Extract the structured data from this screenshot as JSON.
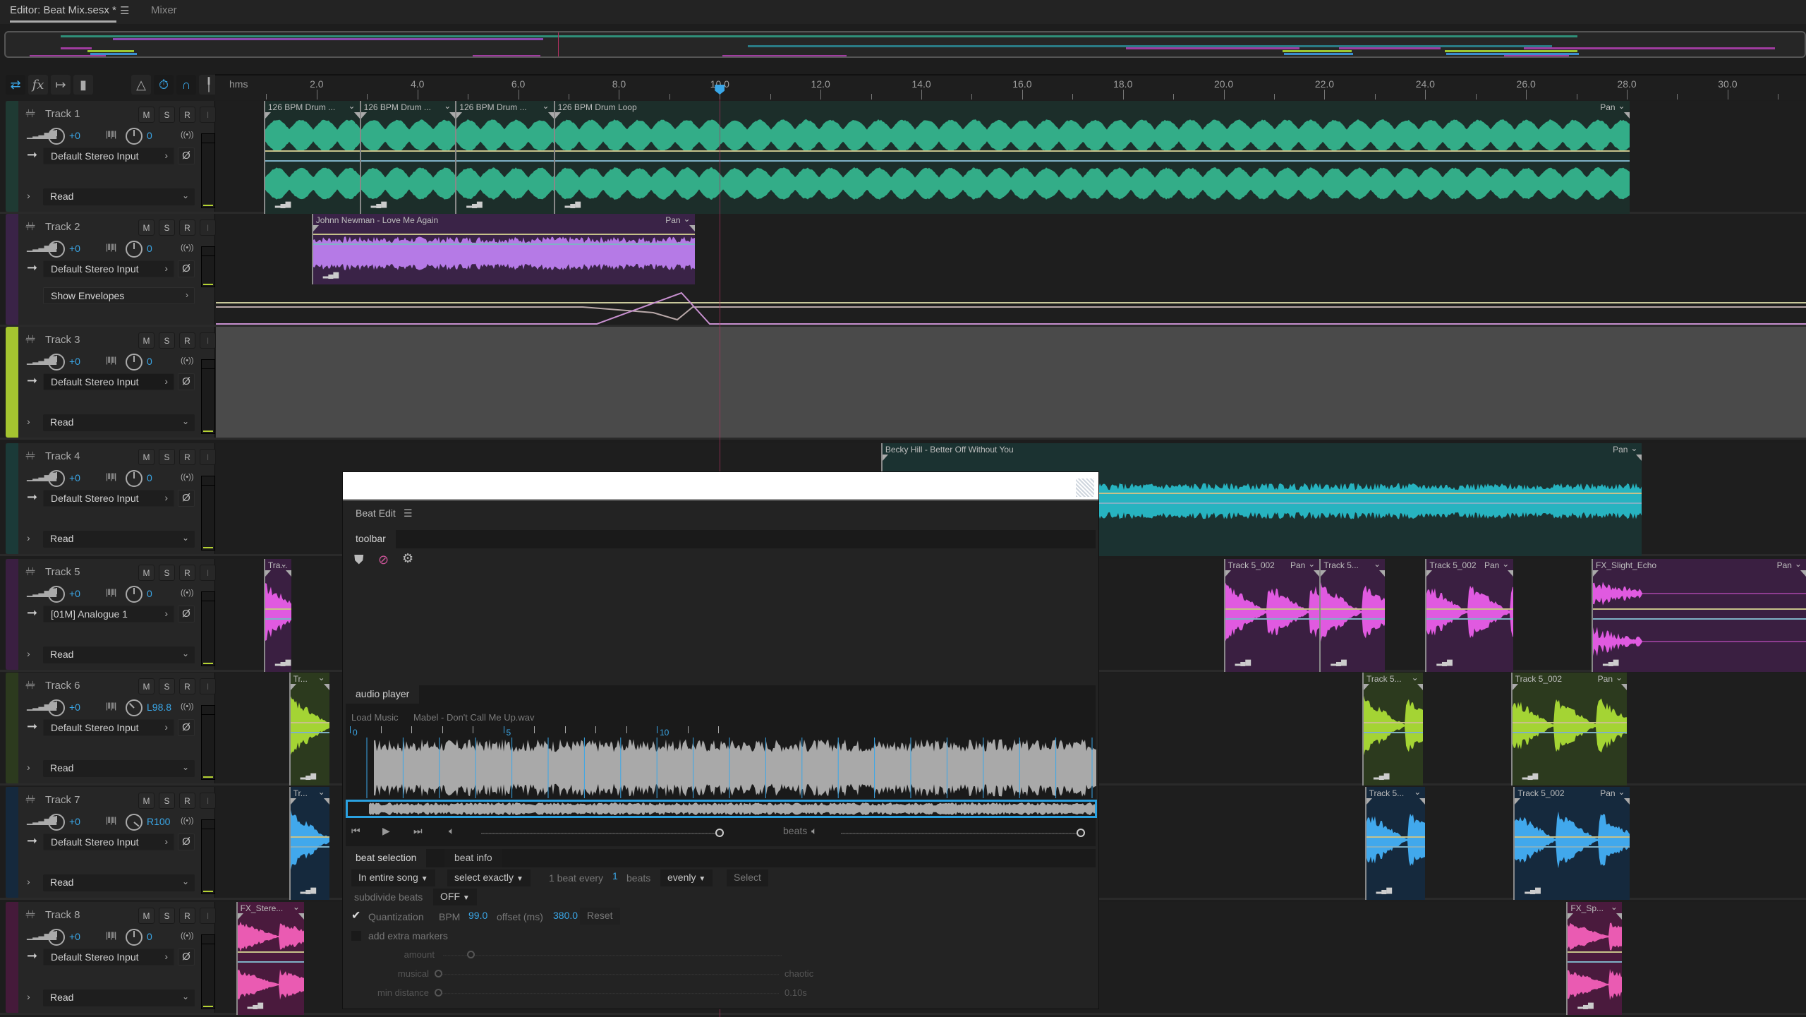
{
  "tabs": {
    "editor": "Editor: Beat Mix.sesx *",
    "menu_icon": "☰",
    "mixer": "Mixer"
  },
  "ruler": {
    "unit": "hms",
    "labels": [
      "2.0",
      "4.0",
      "6.0",
      "8.0",
      "10.0",
      "12.0",
      "14.0",
      "16.0",
      "18.0",
      "20.0",
      "22.0",
      "24.0",
      "26.0",
      "28.0",
      "30.0"
    ],
    "playhead_seconds": 10.0
  },
  "tracks": [
    {
      "name": "Track 1",
      "volume": "+0",
      "pan": "0",
      "input": "Default Stereo Input",
      "automation": "Read",
      "color": "#1f3a33"
    },
    {
      "name": "Track 2",
      "volume": "+0",
      "pan": "0",
      "input": "Default Stereo Input",
      "automation": "Show Envelopes",
      "color": "#3a2347"
    },
    {
      "name": "Track 3",
      "volume": "+0",
      "pan": "0",
      "input": "Default Stereo Input",
      "automation": "Read",
      "color": "#a5c530"
    },
    {
      "name": "Track 4",
      "volume": "+0",
      "pan": "0",
      "input": "Default Stereo Input",
      "automation": "Read",
      "color": "#1b3a38"
    },
    {
      "name": "Track 5",
      "volume": "+0",
      "pan": "0",
      "input": "[01M] Analogue 1",
      "automation": "Read",
      "color": "#3a1f41"
    },
    {
      "name": "Track 6",
      "volume": "+0",
      "pan": "L98.8",
      "input": "Default Stereo Input",
      "automation": "Read",
      "color": "#2c3a1e"
    },
    {
      "name": "Track 7",
      "volume": "+0",
      "pan": "R100",
      "input": "Default Stereo Input",
      "automation": "Read",
      "color": "#15293d"
    },
    {
      "name": "Track 8",
      "volume": "+0",
      "pan": "0",
      "input": "Default Stereo Input",
      "automation": "Read",
      "color": "#451a3a"
    }
  ],
  "track_buttons": {
    "mute": "M",
    "solo": "S",
    "record": "R",
    "input": "I"
  },
  "clips": {
    "t1": [
      {
        "title": "126 BPM Drum ...",
        "start": 0.95,
        "end": 2.85
      },
      {
        "title": "126 BPM Drum ...",
        "start": 2.85,
        "end": 4.75
      },
      {
        "title": "126 BPM Drum ...",
        "start": 4.75,
        "end": 6.7
      },
      {
        "title": "126 BPM Drum Loop",
        "start": 6.7,
        "end": 28.05,
        "pan": "Pan"
      }
    ],
    "t2": [
      {
        "title": "Johnn Newman - Love Me Again",
        "start": 1.9,
        "end": 9.5,
        "pan": "Pan"
      }
    ],
    "t4": [
      {
        "title": "Becky Hill - Better Off Without You",
        "start": 13.2,
        "end": 28.3,
        "pan": "Pan"
      }
    ],
    "t5": [
      {
        "title": "Tra...",
        "start": 0.95,
        "end": 1.5
      },
      {
        "title": "Track 5_002",
        "start": 20.0,
        "end": 21.9,
        "pan": "Pan"
      },
      {
        "title": "Track 5...",
        "start": 21.9,
        "end": 23.2
      },
      {
        "title": "Track 5_002",
        "start": 24.0,
        "end": 25.75,
        "pan": "Pan"
      },
      {
        "title": "FX_Slight_Echo",
        "start": 27.3,
        "end": 32.0,
        "pan": "Pan"
      }
    ],
    "t6": [
      {
        "title": "Tr...",
        "start": 1.45,
        "end": 2.25
      },
      {
        "title": "Track 5...",
        "start": 22.75,
        "end": 23.95
      },
      {
        "title": "Track 5_002",
        "start": 25.7,
        "end": 28.0,
        "pan": "Pan"
      }
    ],
    "t7": [
      {
        "title": "Tr...",
        "start": 1.45,
        "end": 2.25
      },
      {
        "title": "Track 5...",
        "start": 22.8,
        "end": 24.0
      },
      {
        "title": "Track 5_002",
        "start": 25.75,
        "end": 28.05,
        "pan": "Pan"
      }
    ],
    "t8": [
      {
        "title": "FX_Stere...",
        "start": 0.4,
        "end": 1.75
      },
      {
        "title": "FX_Sp...",
        "start": 26.8,
        "end": 27.9
      }
    ]
  },
  "beat_edit": {
    "title": "Beat Edit",
    "menu_icon": "☰",
    "toolbar_tab": "toolbar",
    "toolbar_icons": [
      "marker-icon",
      "remove-marker-icon",
      "settings-gear-icon"
    ],
    "audio_player_tab": "audio player",
    "load_music": "Load Music",
    "file_name": "Mabel - Don't Call Me Up.wav",
    "timeline_labels": [
      "0",
      "5",
      "10"
    ],
    "beats_label": "beats",
    "volume_level": 1.0,
    "beats_volume_level": 1.0,
    "tabs": [
      "beat selection",
      "beat info"
    ],
    "scope": "In entire song",
    "mode": "select exactly",
    "beat_every_prefix": "1 beat every",
    "beat_every_value": "1",
    "beat_every_suffix": "beats",
    "distribution": "evenly",
    "select_button": "Select",
    "subdivide_label": "subdivide beats",
    "subdivide_value": "OFF",
    "quantization_label": "Quantization",
    "quantization_checked": true,
    "bpm_label": "BPM",
    "bpm_value": "99.0",
    "offset_label": "offset (ms)",
    "offset_value": "380.0",
    "reset_button": "Reset",
    "extra_markers_label": "add extra markers",
    "extra_markers_checked": false,
    "amount_label": "amount",
    "musical_label": "musical",
    "chaotic_label": "chaotic",
    "min_distance_label": "min distance",
    "min_distance_value": "0.10s"
  }
}
